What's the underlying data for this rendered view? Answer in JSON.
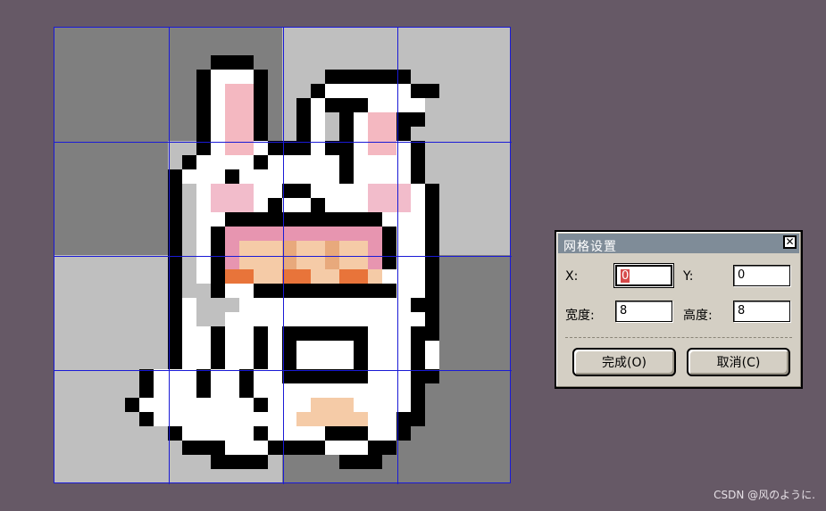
{
  "canvas": {
    "columns": 32,
    "rows": 32,
    "grid_divisions": 4,
    "colors": {
      "grid_line": "#1a1ad6",
      "bg_light": "#bfbfbf",
      "bg_dark": "#7f7f7f",
      "outline": "#000000",
      "fur": "#ffffff",
      "fur_shadow": "#c0c0c0",
      "ear_pink": "#f4b8c1",
      "cheek_pink": "#f2bccb",
      "hair_pink": "#e795b0",
      "skin": "#f5cba7",
      "skin_dark": "#e8a97c",
      "bow_orange": "#e8743a",
      "tail_pink": "#e7a0b8"
    },
    "background_pattern": [
      [
        "dark",
        "dark",
        "light",
        "light"
      ],
      [
        "dark",
        "light",
        "light",
        "light"
      ],
      [
        "light",
        "light",
        "light",
        "dark"
      ],
      [
        "light",
        "light",
        "dark",
        "dark"
      ]
    ],
    "sprite": [
      "................................",
      "................................",
      "...........kkk..................",
      "..........kwwwk....kkkkkk.......",
      "..........kwppk...kwwwwwwkk.....",
      "..........kwppk..kwkkkwwww......",
      "..........kwppk..kw.kwppkk......",
      "..........kwppk..kw.kwppk.......",
      "..........kwppwkkkwkkwppwk......",
      ".........kwwwwkwwwwwkwwwwk......",
      "........kwwwkwwwwwwwkwwwwk......",
      "........kswcccwwkkwwwwcccwk.....",
      "........kswcccwkwwkwwwcccwk.....",
      "........kswwkkkkkkkkkkkwwwk.....",
      "........kswkhhhhhhhhhhhkwwk.....",
      "........kswkhtttyttytthkwwk.....",
      "........kswkhtttyttytthkwwk.....",
      "........kswkoottoottootwwwk.....",
      "........ksskwwkkkkkkkkkkwwk.....",
      "........kwssswwwwwwwwwwwwkk.....",
      "........kwsswwwwwwwwwwwwwwk.....",
      "........kwwkwwkwkkkkkkwwwkk.....",
      "........kwwkwwkwkwwwwkwwwkw.....",
      "........kwwkwwkwkwwwwkwwwkw.....",
      "......kwwwkwwkwwkkkkkkwwwkk.....",
      "......kwwwkwwkwwwwwwwwwwwk......",
      ".....kwwwwwwwwkwwwtttwwwwk......",
      "......kwwwwwwwwwwtttttwwkk......",
      "........kwwwwwkwwwwkkkwwk.......",
      ".........kkkwwwkkkkwwwkk........",
      "...........kkkk.....kkk.........",
      "................................"
    ],
    "legend": {
      "k": "outline",
      "w": "fur",
      "s": "fur_shadow",
      "p": "ear_pink",
      "c": "cheek_pink",
      "h": "hair_pink",
      "t": "skin",
      "y": "skin_dark",
      "o": "bow_orange"
    }
  },
  "dialog": {
    "title": "网格设置",
    "close_glyph": "✕",
    "x_label": "X:",
    "x_value": "0",
    "y_label": "Y:",
    "y_value": "0",
    "width_label": "宽度:",
    "width_value": "8",
    "height_label": "高度:",
    "height_value": "8",
    "ok_label": "完成(O)",
    "cancel_label": "取消(C)"
  },
  "watermark": "CSDN @风のように."
}
